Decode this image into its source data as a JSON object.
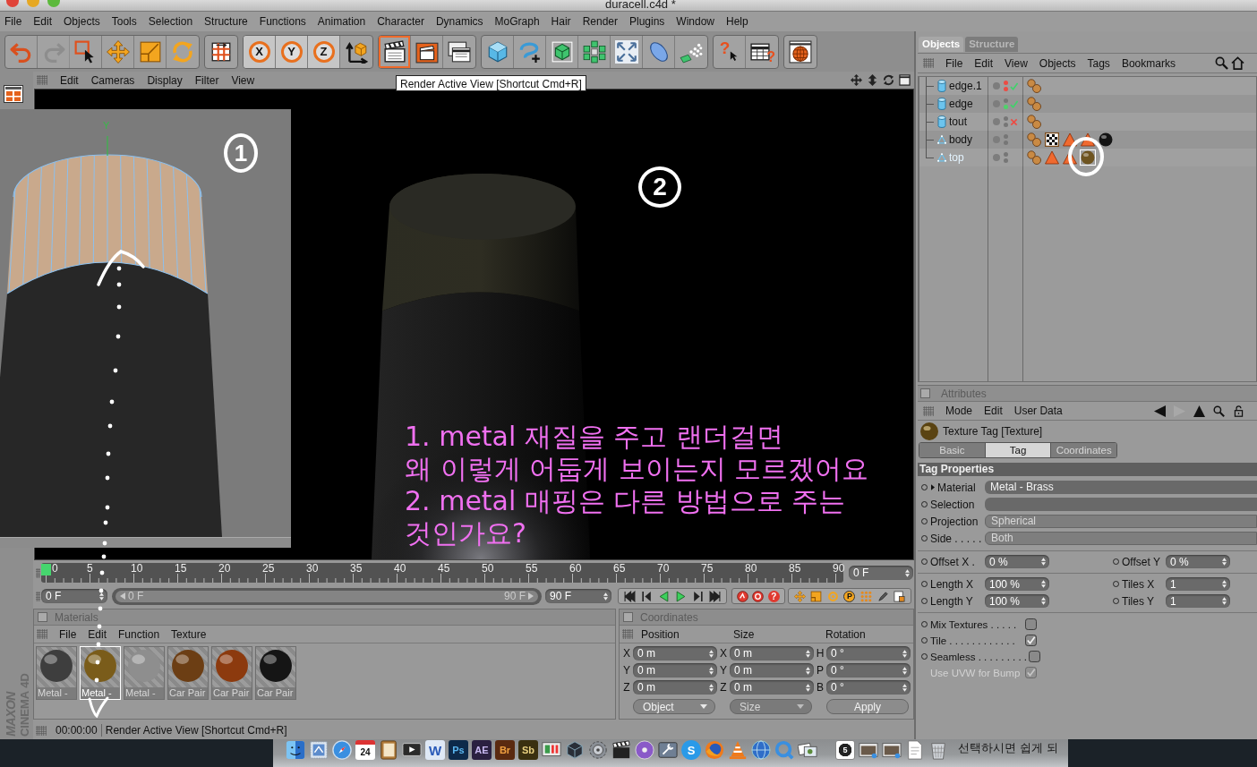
{
  "window": {
    "title": "duracell.c4d *"
  },
  "menu_bar": [
    "File",
    "Edit",
    "Objects",
    "Tools",
    "Selection",
    "Structure",
    "Functions",
    "Animation",
    "Character",
    "Dynamics",
    "MoGraph",
    "Hair",
    "Render",
    "Plugins",
    "Window",
    "Help"
  ],
  "toolbar": {
    "redo": {
      "disabled": true
    },
    "axis_buttons": [
      {
        "label": "X",
        "on": true
      },
      {
        "label": "Y",
        "on": true
      },
      {
        "label": "Z",
        "on": true
      }
    ],
    "render_active": {
      "hovered": true
    },
    "help_marks": [
      "?",
      "?"
    ],
    "tooltip": "Render Active View [Shortcut Cmd+R]"
  },
  "viewport": {
    "menu": [
      "Edit",
      "Cameras",
      "Display",
      "Filter",
      "View"
    ],
    "marker": "2",
    "note_lines": [
      "1. metal 재질을 주고 랜더걸면",
      "왜 이렇게 어둡게 보이는지 모르겠어요",
      "2. metal 매핑은 다른 방법으로 주는",
      "것인가요?"
    ]
  },
  "editor_view": {
    "axis_label": "Y",
    "marker": "1"
  },
  "timeline": {
    "playhead": {
      "level": 0,
      "label": "0"
    },
    "ticks": [
      "5",
      "10",
      "15",
      "20",
      "25",
      "30",
      "35",
      "40",
      "45",
      "50",
      "55",
      "60",
      "65",
      "70",
      "75",
      "80",
      "85",
      "90"
    ],
    "current_frame": "0 F",
    "start_field": "0 F",
    "range": {
      "start": "0 F",
      "end": "90 F",
      "level": 1
    },
    "end_field": "90 F",
    "keyframe_mark": "?",
    "param_mark": "P"
  },
  "materials": {
    "title": "Materials",
    "menu": [
      "File",
      "Edit",
      "Function",
      "Texture"
    ],
    "items": [
      {
        "name": "Metal -",
        "color": "#3e3e3e",
        "selected": false
      },
      {
        "name": "Metal -",
        "color": "#7a5c1a",
        "selected": true
      },
      {
        "name": "Metal -",
        "color": "#8e8e8e",
        "selected": false
      },
      {
        "name": "Car Pair",
        "color": "#6c3e14",
        "selected": false
      },
      {
        "name": "Car Pair",
        "color": "#8c3a0e",
        "selected": false
      },
      {
        "name": "Car Pair",
        "color": "#151515",
        "selected": false
      }
    ]
  },
  "coordinates": {
    "title": "Coordinates",
    "columns": [
      "Position",
      "Size",
      "Rotation"
    ],
    "rows": [
      {
        "position_axis": "X",
        "position": "0 m",
        "size_axis": "X",
        "size": "0 m",
        "rotation_axis": "H",
        "rotation": "0 °"
      },
      {
        "position_axis": "Y",
        "position": "0 m",
        "size_axis": "Y",
        "size": "0 m",
        "rotation_axis": "P",
        "rotation": "0 °"
      },
      {
        "position_axis": "Z",
        "position": "0 m",
        "size_axis": "Z",
        "size": "0 m",
        "rotation_axis": "B",
        "rotation": "0 °"
      }
    ],
    "dropdowns": [
      {
        "label": "Object",
        "disabled": false
      },
      {
        "label": "Size",
        "disabled": true
      }
    ],
    "apply": "Apply"
  },
  "status_bar": {
    "time": "00:00:00",
    "message": "Render Active View [Shortcut Cmd+R]"
  },
  "logo": [
    "MAXON",
    "CINEMA 4D"
  ],
  "object_manager": {
    "tabs": [
      {
        "label": "Objects",
        "selected": true
      },
      {
        "label": "Structure",
        "selected": false
      }
    ],
    "menu": [
      "File",
      "Edit",
      "View",
      "Objects",
      "Tags",
      "Bookmarks"
    ],
    "objects": [
      {
        "name": "edge.1",
        "kind": "cylinder",
        "selected": false,
        "visibility": [
          {
            "color": "#ec4c44"
          },
          {
            "color": "#ec4c44"
          }
        ],
        "enabled": true,
        "tags": [
          {
            "kind": "phong",
            "selected": false
          }
        ]
      },
      {
        "name": "edge",
        "kind": "cylinder",
        "selected": false,
        "visibility": [
          {
            "color": "#767676"
          },
          {
            "color": "#4fd36a"
          }
        ],
        "enabled": true,
        "tags": [
          {
            "kind": "phong",
            "selected": false
          }
        ]
      },
      {
        "name": "tout",
        "kind": "cylinder",
        "selected": false,
        "visibility": [
          {
            "color": "#767676"
          },
          {
            "color": "#767676"
          }
        ],
        "enabled": false,
        "tags": [
          {
            "kind": "phong",
            "selected": false
          }
        ]
      },
      {
        "name": "body",
        "kind": "polygon",
        "selected": false,
        "visibility": [
          {
            "color": "#767676"
          },
          {
            "color": "#767676"
          }
        ],
        "tags": [
          {
            "kind": "phong",
            "selected": false
          },
          {
            "kind": "checker",
            "selected": false
          },
          {
            "kind": "selection",
            "selected": false
          },
          {
            "kind": "selection",
            "selected": false
          },
          {
            "kind": "sphere",
            "color": "#141414",
            "selected": false
          }
        ]
      },
      {
        "name": "top",
        "kind": "polygon",
        "selected": true,
        "visibility": [
          {
            "color": "#767676"
          },
          {
            "color": "#767676"
          }
        ],
        "tags": [
          {
            "kind": "phong",
            "selected": false
          },
          {
            "kind": "selection",
            "selected": false
          },
          {
            "kind": "selection",
            "selected": false
          },
          {
            "kind": "sphere",
            "color": "#6e5420",
            "selected": true
          }
        ]
      }
    ]
  },
  "attributes": {
    "title": "Attributes",
    "menu": [
      "Mode",
      "Edit",
      "User Data"
    ],
    "heading": "Texture Tag [Texture]",
    "tabs": [
      {
        "label": "Basic",
        "selected": false
      },
      {
        "label": "Tag",
        "selected": true
      },
      {
        "label": "Coordinates",
        "selected": false
      }
    ],
    "section": "Tag Properties",
    "fields": [
      {
        "label": "Material",
        "kind": "link",
        "value": "Metal - Brass"
      },
      {
        "label": "Selection",
        "kind": "text"
      },
      {
        "label": "Projection",
        "kind": "dropdown",
        "value": "Spherical"
      },
      {
        "label": "Side . . . . .",
        "kind": "dropdown",
        "value": "Both"
      }
    ],
    "number_groups": [
      [
        {
          "left": {
            "label": "Offset X .",
            "value": "0 %"
          },
          "right": {
            "label": "Offset Y",
            "value": "0 %"
          }
        }
      ],
      [
        {
          "left": {
            "label": "Length X",
            "value": "100 %"
          },
          "right": {
            "label": "Tiles X",
            "value": "1"
          }
        },
        {
          "left": {
            "label": "Length Y",
            "value": "100 %"
          },
          "right": {
            "label": "Tiles Y",
            "value": "1"
          }
        }
      ]
    ],
    "options": [
      {
        "label": "Mix Textures . . . . .",
        "checked": false,
        "disabled": false
      },
      {
        "label": "Tile . . . . . . . . . . . .",
        "checked": true,
        "disabled": false
      },
      {
        "label": "Seamless . . . . . . . . .",
        "checked": false,
        "disabled": false
      },
      {
        "label": "Use UVW for Bump",
        "checked": true,
        "disabled": true
      }
    ]
  },
  "dock": {
    "labels": [
      "24",
      "W",
      "Ps",
      "AE",
      "Br",
      "Sb",
      "S",
      "5"
    ],
    "caption": "선택하시면 쉽게 되"
  }
}
